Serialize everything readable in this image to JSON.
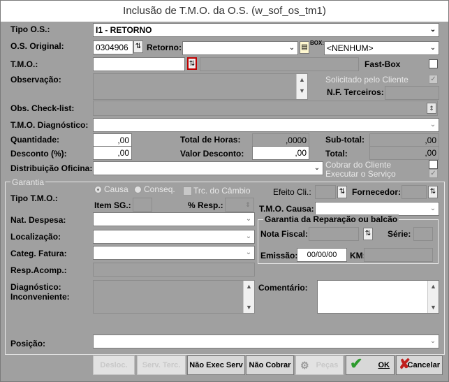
{
  "window": {
    "title": "Inclusão de T.M.O. da O.S. (w_sof_os_tm1)"
  },
  "tipo_os": {
    "label": "Tipo O.S.:",
    "value": "I1 - RETORNO"
  },
  "os_original": {
    "label": "O.S. Original:",
    "value": "0304906",
    "retorno_label": "Retorno:",
    "retorno_value": "",
    "box_label": "BOX:",
    "box_value": "<NENHUM>"
  },
  "tmo": {
    "label": "T.M.O.:",
    "value": "",
    "fastbox_label": "Fast-Box"
  },
  "observacao": {
    "label": "Observação:",
    "solicitado_label": "Solicitado pelo Cliente",
    "nf_terceiros_label": "N.F. Terceiros:"
  },
  "obs_checklist": {
    "label": "Obs. Check-list:"
  },
  "tmo_diagnostico": {
    "label": "T.M.O. Diagnóstico:"
  },
  "quantidade": {
    "label": "Quantidade:",
    "value": ",00",
    "total_horas_label": "Total de Horas:",
    "total_horas_value": ",0000",
    "subtotal_label": "Sub-total:",
    "subtotal_value": ",00"
  },
  "desconto": {
    "label": "Desconto (%):",
    "value": ",00",
    "valor_desconto_label": "Valor Desconto:",
    "valor_desconto_value": ",00",
    "total_label": "Total:",
    "total_value": ",00"
  },
  "distribuicao": {
    "label": "Distribuição Oficina:",
    "cobrar_label": "Cobrar do Cliente",
    "executar_label": "Executar o Serviço"
  },
  "garantia": {
    "group_label": "Garantia",
    "tipo_tmo_label": "Tipo T.M.O.:",
    "causa_label": "Causa",
    "conseq_label": "Conseq.",
    "trc_cambio_label": "Trc. do Câmbio",
    "efeito_cli_label": "Efeito Cli.:",
    "fornecedor_label": "Fornecedor:",
    "item_sg_label": "Item SG.:",
    "resp_label": "% Resp.:",
    "tmo_causa_label": "T.M.O. Causa:",
    "nat_despesa_label": "Nat. Despesa:",
    "localizacao_label": "Localização:",
    "categ_fatura_label": "Categ. Fatura:",
    "resp_acomp_label": "Resp.Acomp.:",
    "diagnostico_label": "Diagnóstico:",
    "inconveniente_label": "Inconveniente:",
    "comentario_label": "Comentário:",
    "reparacao": {
      "group_label": "Garantia da Reparação ou balcão",
      "nota_fiscal_label": "Nota Fiscal:",
      "serie_label": "Série:",
      "emissao_label": "Emissão:",
      "emissao_value": "00/00/00",
      "km_label": "KM:"
    }
  },
  "posicao": {
    "label": "Posição:"
  },
  "buttons": {
    "desloc": "Desloc.",
    "serv_terc": "Serv. Terc.",
    "nao_exec_serv": "Não Exec Serv",
    "nao_cobrar": "Não Cobrar",
    "pecas": "Peças",
    "ok": "OK",
    "cancelar": "Cancelar"
  },
  "colors": {
    "background": "#a0a0a0",
    "ok_icon": "#2e9b2e",
    "cancel_icon": "#c0201e",
    "lookup_highlight": "#c00000"
  },
  "icons": {
    "dropdown": "chevron-down-icon",
    "lookup": "lookup-icon",
    "note": "document-icon",
    "spin": "spin-arrows-icon",
    "ok": "check-icon",
    "cancel": "x-icon",
    "pecas": "parts-icon"
  }
}
